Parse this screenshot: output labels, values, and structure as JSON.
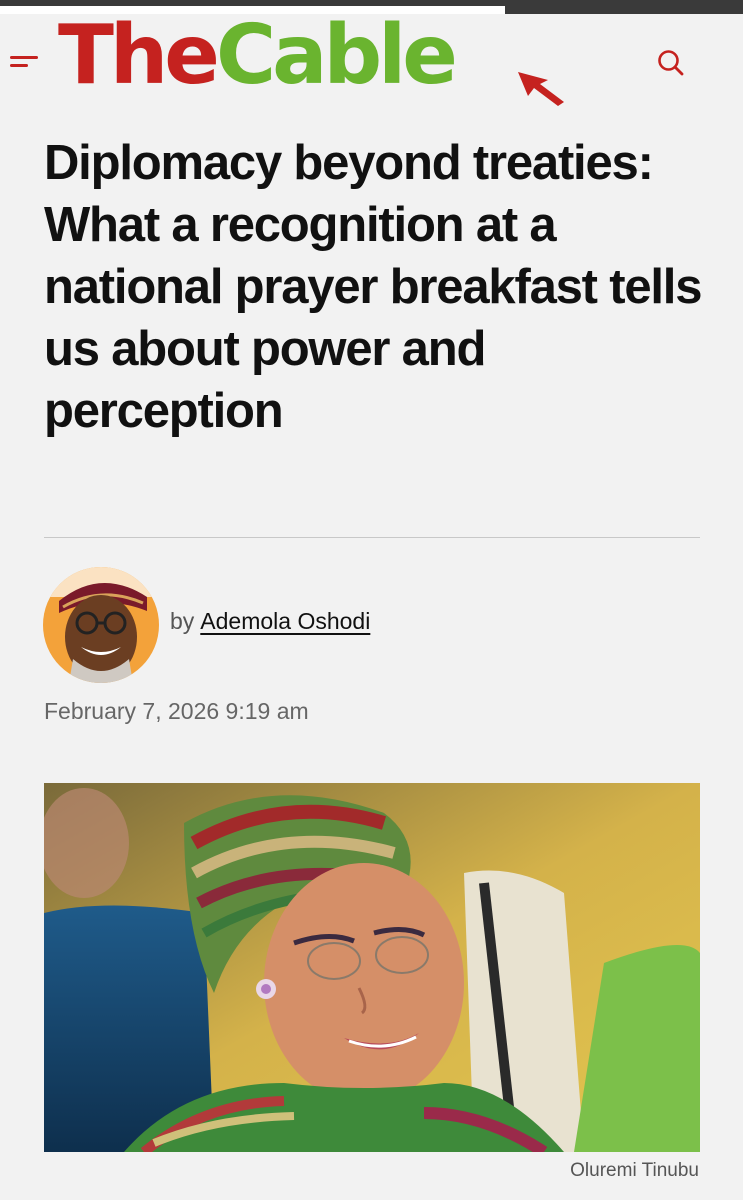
{
  "site": {
    "logo_part1": "The",
    "logo_part2": "Cable",
    "brand_red": "#c5221f",
    "brand_green": "#6ab42f"
  },
  "header": {
    "menu_icon": "hamburger-menu-icon",
    "search_icon": "search-icon"
  },
  "article": {
    "headline": "Diplomacy beyond treaties: What a recognition at a national prayer breakfast tells us about power and perception",
    "by_prefix": "by",
    "author": "Ademola Oshodi",
    "date": "February 7, 2026 9:19 am",
    "image_caption": "Oluremi Tinubu"
  }
}
